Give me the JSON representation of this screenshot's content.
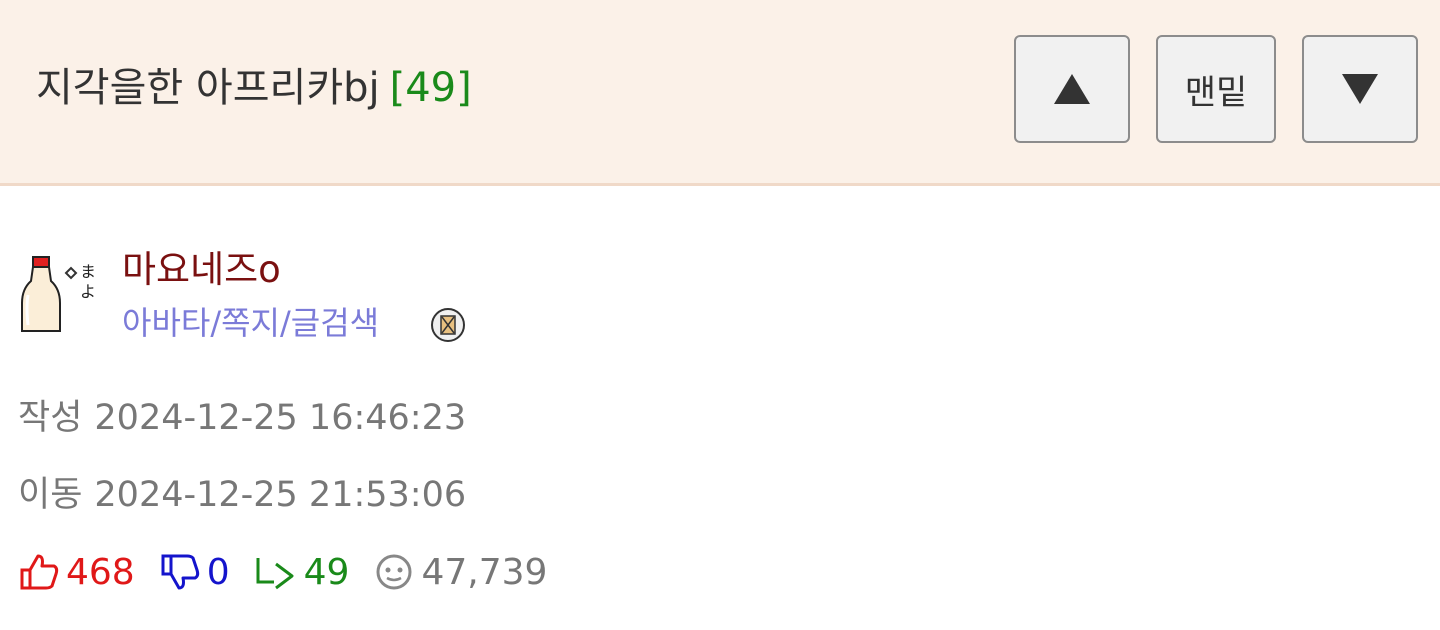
{
  "header": {
    "title": "지각을한 아프리카bj",
    "comment_count": "[49]",
    "buttons": {
      "up_icon": "triangle-up-icon",
      "bottom_label": "맨밑",
      "down_icon": "triangle-down-icon"
    }
  },
  "author": {
    "avatar_icon": "mayonnaise-bottle-icon",
    "nickname": "마요네즈o",
    "links": "아바타/쪽지/글검색",
    "memo_icon": "memo-icon"
  },
  "meta": {
    "written_label": "작성",
    "written_time": "2024-12-25 16:46:23",
    "moved_label": "이동",
    "moved_time": "2024-12-25 21:53:06"
  },
  "stats": {
    "likes": "468",
    "dislikes": "0",
    "replies": "49",
    "views": "47,739",
    "colors": {
      "likes": "#e01818",
      "dislikes": "#1414cc",
      "replies": "#1a8a1a",
      "views": "#777777"
    }
  }
}
